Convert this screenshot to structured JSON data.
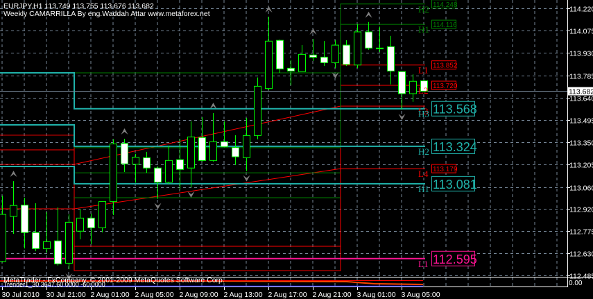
{
  "header": {
    "symbol_line": "EURJPY,H1  113.749 113.755 113.676 113.682",
    "indicator_title": "Weekly CAMARRILLA By eng.Waddah Attar  www.metaforex.net"
  },
  "footer": {
    "copyright": "MetaTrader - FxCompany, © 2001-2009 MetaQuotes Software Corp.",
    "indicator_label": "Trender1_30 3647.60 0000 -60.0000",
    "subwindow_axis_label": "0.00"
  },
  "colors": {
    "background": "#000000",
    "grid": "#778899",
    "bull_candle": "#00FF00",
    "bear_body": "#FFFFFF",
    "weekly_level": "#20B2AA",
    "weekly_l1": "#FF1493",
    "daily_resistance": "#008000",
    "daily_support": "#FF0000",
    "fractal": "#808080",
    "current_price_line": "#778899"
  },
  "chart_data": {
    "type": "candlestick",
    "symbol": "EURJPY",
    "timeframe": "H1",
    "current_price": 113.682,
    "ylim": [
      112.485,
      114.26
    ],
    "grid": true,
    "y_ticks": [
      "114.220",
      "114.075",
      "113.930",
      "113.785",
      "113.640",
      "113.495",
      "113.350",
      "113.205",
      "113.060",
      "112.920",
      "112.775",
      "112.630",
      "112.485"
    ],
    "x_ticks": [
      {
        "label": "30 Jul 2010",
        "time": "30 Jul 17:00"
      },
      {
        "label": "30 Jul 21:00",
        "time": "30 Jul 21:00"
      },
      {
        "label": "2 Aug 01:00",
        "time": "2 Aug 01:00"
      },
      {
        "label": "2 Aug 05:00",
        "time": "2 Aug 05:00"
      },
      {
        "label": "2 Aug 09:00",
        "time": "2 Aug 09:00"
      },
      {
        "label": "2 Aug 13:00",
        "time": "2 Aug 13:00"
      },
      {
        "label": "2 Aug 17:00",
        "time": "2 Aug 17:00"
      },
      {
        "label": "2 Aug 21:00",
        "time": "2 Aug 21:00"
      },
      {
        "label": "3 Aug 01:00",
        "time": "3 Aug 01:00"
      },
      {
        "label": "3 Aug 05:00",
        "time": "3 Aug 05:00"
      }
    ],
    "candles_columns": [
      "time",
      "open",
      "high",
      "low",
      "close"
    ],
    "candles": [
      [
        "30 Jul 17:00",
        112.576,
        113.004,
        112.57,
        112.882
      ],
      [
        "30 Jul 18:00",
        112.869,
        113.098,
        112.756,
        112.94
      ],
      [
        "30 Jul 19:00",
        112.942,
        112.99,
        112.661,
        112.764
      ],
      [
        "30 Jul 20:00",
        112.764,
        112.954,
        112.643,
        112.66
      ],
      [
        "30 Jul 21:00",
        112.66,
        112.896,
        112.634,
        112.705
      ],
      [
        "30 Jul 22:00",
        112.71,
        112.927,
        112.55,
        112.561
      ],
      [
        "30 Jul 23:00",
        112.565,
        112.882,
        112.526,
        112.831
      ],
      [
        "2 Aug 00:00",
        112.773,
        112.914,
        112.72,
        112.858
      ],
      [
        "2 Aug 01:00",
        112.858,
        112.887,
        112.689,
        112.795
      ],
      [
        "2 Aug 02:00",
        112.795,
        112.966,
        112.765,
        112.966
      ],
      [
        "2 Aug 03:00",
        112.966,
        113.37,
        112.878,
        113.34
      ],
      [
        "2 Aug 04:00",
        113.343,
        113.373,
        113.157,
        113.21
      ],
      [
        "2 Aug 05:00",
        113.208,
        113.275,
        113.088,
        113.253
      ],
      [
        "2 Aug 06:00",
        113.25,
        113.288,
        113.152,
        113.183
      ],
      [
        "2 Aug 07:00",
        113.183,
        113.193,
        112.983,
        113.091
      ],
      [
        "2 Aug 08:00",
        113.091,
        113.328,
        113.08,
        113.232
      ],
      [
        "2 Aug 09:00",
        113.237,
        113.373,
        113.044,
        113.174
      ],
      [
        "2 Aug 10:00",
        113.183,
        113.486,
        113.058,
        113.385
      ],
      [
        "2 Aug 11:00",
        113.381,
        113.513,
        113.225,
        113.232
      ],
      [
        "2 Aug 12:00",
        113.232,
        113.54,
        113.225,
        113.354
      ],
      [
        "2 Aug 13:00",
        113.354,
        113.486,
        113.318,
        113.321
      ],
      [
        "2 Aug 14:00",
        113.316,
        113.396,
        113.202,
        113.256
      ],
      [
        "2 Aug 15:00",
        113.25,
        113.508,
        113.163,
        113.394
      ],
      [
        "2 Aug 16:00",
        113.394,
        113.771,
        113.37,
        113.714
      ],
      [
        "2 Aug 17:00",
        113.699,
        114.166,
        113.689,
        114.007
      ],
      [
        "2 Aug 18:00",
        114.012,
        114.017,
        113.801,
        113.827
      ],
      [
        "2 Aug 19:00",
        113.831,
        113.884,
        113.72,
        113.813
      ],
      [
        "2 Aug 20:00",
        113.809,
        113.981,
        113.809,
        113.921
      ],
      [
        "2 Aug 21:00",
        113.917,
        114.022,
        113.878,
        113.902
      ],
      [
        "2 Aug 22:00",
        113.903,
        114.008,
        113.846,
        113.867
      ],
      [
        "2 Aug 23:00",
        113.867,
        114.013,
        113.832,
        113.981
      ],
      [
        "3 Aug 00:00",
        113.981,
        114.013,
        113.846,
        113.856
      ],
      [
        "3 Aug 01:00",
        113.852,
        114.117,
        113.832,
        114.067
      ],
      [
        "3 Aug 02:00",
        114.067,
        114.131,
        113.951,
        113.962
      ],
      [
        "3 Aug 03:00",
        113.962,
        114.101,
        113.937,
        113.962
      ],
      [
        "3 Aug 04:00",
        113.971,
        114.041,
        113.726,
        113.813
      ],
      [
        "3 Aug 05:00",
        113.809,
        113.809,
        113.562,
        113.666
      ],
      [
        "3 Aug 06:00",
        113.666,
        113.791,
        113.613,
        113.746
      ],
      [
        "3 Aug 07:00",
        113.749,
        113.755,
        113.676,
        113.682
      ]
    ],
    "fractals": [
      {
        "time": "30 Jul 18:00",
        "type": "up"
      },
      {
        "time": "2 Aug 04:00",
        "type": "up"
      },
      {
        "time": "2 Aug 12:00",
        "type": "up"
      },
      {
        "time": "2 Aug 17:00",
        "type": "up"
      },
      {
        "time": "2 Aug 21:00",
        "type": "up"
      },
      {
        "time": "3 Aug 02:00",
        "type": "up"
      },
      {
        "time": "30 Jul 23:00",
        "type": "down"
      },
      {
        "time": "2 Aug 07:00",
        "type": "down"
      },
      {
        "time": "2 Aug 10:00",
        "type": "down"
      },
      {
        "time": "2 Aug 15:00",
        "type": "down"
      },
      {
        "time": "2 Aug 23:00",
        "type": "down"
      },
      {
        "time": "3 Aug 05:00",
        "type": "down"
      }
    ],
    "weekly_levels": [
      {
        "name": "H3",
        "color": "#20B2AA",
        "steps": [
          {
            "from": "30 Jul 17:00",
            "to": "30 Jul 23:00",
            "price": 113.801
          },
          {
            "from": "2 Aug 00:00",
            "to": "3 Aug 07:00",
            "price": 113.568
          }
        ]
      },
      {
        "name": "H2",
        "color": "#20B2AA",
        "steps": [
          {
            "from": "30 Jul 17:00",
            "to": "30 Jul 23:00",
            "price": 113.463
          },
          {
            "from": "2 Aug 00:00",
            "to": "3 Aug 07:00",
            "price": 113.324
          }
        ]
      },
      {
        "name": "H1",
        "color": "#20B2AA",
        "steps": [
          {
            "from": "30 Jul 17:00",
            "to": "30 Jul 23:00",
            "price": 113.193
          },
          {
            "from": "2 Aug 00:00",
            "to": "3 Aug 07:00",
            "price": 113.081
          }
        ]
      },
      {
        "name": "L1",
        "color": "#FF1493",
        "steps": [
          {
            "from": "30 Jul 17:00",
            "to": "3 Aug 07:00",
            "price": 112.595
          }
        ]
      }
    ],
    "daily_levels": [
      {
        "color": "#FF0000",
        "steps": [
          {
            "from": "30 Jul 17:00",
            "to": "30 Jul 23:00",
            "price": 113.396
          },
          {
            "from": "2 Aug 00:00",
            "to": "2 Aug 23:00",
            "price": 112.675
          },
          {
            "from": "3 Aug 00:00",
            "to": "3 Aug 07:00",
            "price": 113.852
          }
        ]
      },
      {
        "color": "#FF0000",
        "steps": [
          {
            "from": "30 Jul 17:00",
            "to": "30 Jul 23:00",
            "price": 113.301
          },
          {
            "from": "2 Aug 00:00",
            "to": "2 Aug 23:00",
            "price": 112.517
          },
          {
            "from": "3 Aug 00:00",
            "to": "3 Aug 07:00",
            "price": 113.72
          }
        ]
      },
      {
        "color": "#FF0000",
        "steps": [
          {
            "from": "30 Jul 17:00",
            "to": "30 Jul 23:00",
            "price": 113.207
          },
          {
            "from": "3 Aug 00:00",
            "to": "3 Aug 07:00",
            "price": 113.585
          }
        ]
      },
      {
        "color": "#FF0000",
        "steps": [
          {
            "from": "30 Jul 17:00",
            "to": "30 Jul 23:00",
            "price": 112.918
          },
          {
            "from": "3 Aug 00:00",
            "to": "3 Aug 07:00",
            "price": 113.179
          }
        ]
      },
      {
        "color": "#008000",
        "steps": [
          {
            "from": "2 Aug 00:00",
            "to": "2 Aug 23:00",
            "price": 113.801
          },
          {
            "from": "3 Aug 00:00",
            "to": "3 Aug 07:00",
            "price": 114.248
          }
        ]
      },
      {
        "color": "#008000",
        "steps": [
          {
            "from": "2 Aug 00:00",
            "to": "2 Aug 23:00",
            "price": 113.315
          },
          {
            "from": "3 Aug 00:00",
            "to": "3 Aug 07:00",
            "price": 114.116
          }
        ]
      },
      {
        "color": "#008000",
        "steps": [
          {
            "from": "2 Aug 00:00",
            "to": "2 Aug 23:00",
            "price": 113.152
          }
        ]
      },
      {
        "color": "#008000",
        "steps": [
          {
            "from": "2 Aug 00:00",
            "to": "2 Aug 23:00",
            "price": 112.99
          }
        ]
      }
    ],
    "level_labels": [
      {
        "letter": "H2",
        "value": "114.248",
        "price": 114.248,
        "color": "#008000",
        "size": "small"
      },
      {
        "letter": "H1",
        "value": "114.116",
        "price": 114.116,
        "color": "#008000",
        "size": "small"
      },
      {
        "letter": "L1",
        "value": "113.852",
        "price": 113.852,
        "color": "#FF0000",
        "size": "small"
      },
      {
        "letter": "L2",
        "value": "113.720",
        "price": 113.72,
        "color": "#FF0000",
        "size": "small"
      },
      {
        "letter": "L3",
        "value": "",
        "price": 113.585,
        "color": "#FF0000",
        "size": "small"
      },
      {
        "letter": "H3",
        "value": "113.568",
        "price": 113.568,
        "color": "#20B2AA",
        "size": "big"
      },
      {
        "letter": "H2",
        "value": "113.324",
        "price": 113.324,
        "color": "#20B2AA",
        "size": "big"
      },
      {
        "letter": "L4",
        "value": "113.179",
        "price": 113.179,
        "color": "#FF0000",
        "size": "small"
      },
      {
        "letter": "H1",
        "value": "113.081",
        "price": 113.081,
        "color": "#20B2AA",
        "size": "big"
      },
      {
        "letter": "L1",
        "value": "112.595",
        "price": 112.595,
        "color": "#FF1493",
        "size": "big"
      }
    ]
  }
}
